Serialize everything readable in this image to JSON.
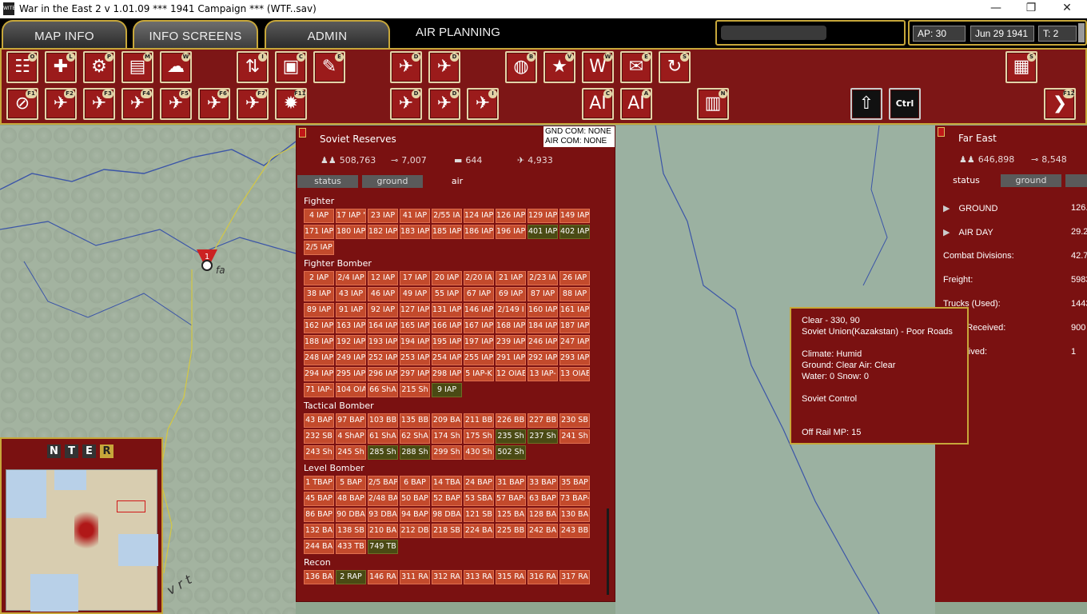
{
  "titlebar": {
    "text": "War in the East 2  v 1.01.09     ***   1941 Campaign   ***    (WTF..sav)",
    "min": "—",
    "max": "❐",
    "close": "✕"
  },
  "tabs": {
    "map_info": "MAP INFO",
    "info_screens": "INFO SCREENS",
    "admin": "ADMIN",
    "air_planning": "AIR PLANNING"
  },
  "status": {
    "ap": "AP: 30",
    "date": "Jun 29 1941",
    "turn": "T: 2"
  },
  "toolbar_row1": [
    {
      "name": "orders-icon",
      "key": "O",
      "g": "☷"
    },
    {
      "name": "leaders-icon",
      "key": "L",
      "g": "✚"
    },
    {
      "name": "production-icon",
      "key": "P",
      "g": "⚙"
    },
    {
      "name": "charts-icon",
      "key": "M",
      "g": "▤"
    },
    {
      "name": "weather-icon",
      "key": "W",
      "g": "☁"
    },
    {
      "name": "transfer-icon",
      "key": "I",
      "g": "⇅"
    },
    {
      "name": "commanders-icon",
      "key": "C",
      "g": "▣"
    },
    {
      "name": "events-icon",
      "key": "E",
      "g": "✎"
    },
    {
      "name": "air-dir-icon",
      "key": "D",
      "g": "✈"
    },
    {
      "name": "air-doc-icon",
      "key": "D",
      "g": "✈"
    },
    {
      "name": "globe-icon",
      "key": "B",
      "g": "◍"
    },
    {
      "name": "victory-icon",
      "key": "V",
      "g": "★"
    },
    {
      "name": "war-report-icon",
      "key": "W",
      "g": "W"
    },
    {
      "name": "announce-icon",
      "key": "E",
      "g": "✉"
    },
    {
      "name": "reload-icon",
      "key": "S",
      "g": "↻"
    }
  ],
  "toolbar_row2": [
    {
      "name": "air-no-icon",
      "key": "F1",
      "g": "⊘"
    },
    {
      "name": "air-ground-icon",
      "key": "F2",
      "g": "✈"
    },
    {
      "name": "air-strike-icon",
      "key": "F3",
      "g": "✈"
    },
    {
      "name": "air-industry-icon",
      "key": "F4",
      "g": "✈"
    },
    {
      "name": "air-patrol-icon",
      "key": "F5",
      "g": "✈"
    },
    {
      "name": "air-multi-icon",
      "key": "F6",
      "g": "✈"
    },
    {
      "name": "air-naval-icon",
      "key": "F7",
      "g": "✈"
    },
    {
      "name": "air-burn-icon",
      "key": "F11",
      "g": "✹"
    },
    {
      "name": "air-dir2-icon",
      "key": "D",
      "g": "✈"
    },
    {
      "name": "air-doc2-icon",
      "key": "D",
      "g": "✈"
    },
    {
      "name": "air-cross-icon",
      "key": "I",
      "g": "✈"
    },
    {
      "name": "ai-city-icon",
      "key": "C",
      "g": "AI"
    },
    {
      "name": "ai-air-icon",
      "key": "A",
      "g": "AI"
    },
    {
      "name": "factory-icon",
      "key": "N",
      "g": "▥"
    },
    {
      "name": "upload-icon",
      "key": "",
      "g": "⇧"
    },
    {
      "name": "ctrl-icon",
      "key": "",
      "g": "Ctrl"
    },
    {
      "name": "next-turn-icon",
      "key": "F12",
      "g": "❯"
    }
  ],
  "hq_icon": {
    "name": "hq-icon",
    "key": "S",
    "g": "▦"
  },
  "panel": {
    "title": "Soviet Reserves",
    "comm1": "GND COM: NONE",
    "comm2": "AIR COM: NONE",
    "men": "508,763",
    "guns": "7,007",
    "tanks": "644",
    "planes": "4,933",
    "tabs": [
      "status",
      "ground",
      "air"
    ]
  },
  "air_groups": [
    {
      "name": "Fighter",
      "units": [
        {
          "l": "4 IAP"
        },
        {
          "l": "17 IAP \""
        },
        {
          "l": "23 IAP"
        },
        {
          "l": "41 IAP"
        },
        {
          "l": "2/55 IA"
        },
        {
          "l": "124 IAP"
        },
        {
          "l": "126 IAP"
        },
        {
          "l": "129 IAP"
        },
        {
          "l": "149 IAP"
        },
        {
          "l": "171 IAP"
        },
        {
          "l": "180 IAP"
        },
        {
          "l": "182 IAP"
        },
        {
          "l": "183 IAP"
        },
        {
          "l": "185 IAP"
        },
        {
          "l": "186 IAP"
        },
        {
          "l": "196 IAP"
        },
        {
          "l": "401 IAP",
          "g": 1
        },
        {
          "l": "402 IAP",
          "g": 1
        },
        {
          "l": "2/5 IAP"
        }
      ]
    },
    {
      "name": "Fighter Bomber",
      "units": [
        {
          "l": "2 IAP"
        },
        {
          "l": "2/4 IAP"
        },
        {
          "l": "12 IAP"
        },
        {
          "l": "17 IAP"
        },
        {
          "l": "20 IAP"
        },
        {
          "l": "2/20 IA"
        },
        {
          "l": "21 IAP"
        },
        {
          "l": "2/23 IA"
        },
        {
          "l": "26 IAP"
        },
        {
          "l": "38 IAP"
        },
        {
          "l": "43 IAP"
        },
        {
          "l": "46 IAP"
        },
        {
          "l": "49 IAP"
        },
        {
          "l": "55 IAP"
        },
        {
          "l": "67 IAP"
        },
        {
          "l": "69 IAP"
        },
        {
          "l": "87 IAP"
        },
        {
          "l": "88 IAP"
        },
        {
          "l": "89 IAP"
        },
        {
          "l": "91 IAP"
        },
        {
          "l": "92 IAP"
        },
        {
          "l": "127 IAP"
        },
        {
          "l": "131 IAP"
        },
        {
          "l": "146 IAP"
        },
        {
          "l": "2/149 I"
        },
        {
          "l": "160 IAP"
        },
        {
          "l": "161 IAP"
        },
        {
          "l": "162 IAP"
        },
        {
          "l": "163 IAP"
        },
        {
          "l": "164 IAP"
        },
        {
          "l": "165 IAP"
        },
        {
          "l": "166 IAP"
        },
        {
          "l": "167 IAP"
        },
        {
          "l": "168 IAP"
        },
        {
          "l": "184 IAP"
        },
        {
          "l": "187 IAP"
        },
        {
          "l": "188 IAP"
        },
        {
          "l": "192 IAP"
        },
        {
          "l": "193 IAP"
        },
        {
          "l": "194 IAP"
        },
        {
          "l": "195 IAP"
        },
        {
          "l": "197 IAP"
        },
        {
          "l": "239 IAP"
        },
        {
          "l": "246 IAP"
        },
        {
          "l": "247 IAP"
        },
        {
          "l": "248 IAP"
        },
        {
          "l": "249 IAP"
        },
        {
          "l": "252 IAP"
        },
        {
          "l": "253 IAP"
        },
        {
          "l": "254 IAP"
        },
        {
          "l": "255 IAP"
        },
        {
          "l": "291 IAP"
        },
        {
          "l": "292 IAP"
        },
        {
          "l": "293 IAP"
        },
        {
          "l": "294 IAP"
        },
        {
          "l": "295 IAP"
        },
        {
          "l": "296 IAP"
        },
        {
          "l": "297 IAP"
        },
        {
          "l": "298 IAP"
        },
        {
          "l": "5 IAP-K"
        },
        {
          "l": "12 OIAE"
        },
        {
          "l": "13 IAP-"
        },
        {
          "l": "13 OIAE"
        },
        {
          "l": "71 IAP-"
        },
        {
          "l": "104 OIA"
        },
        {
          "l": "66 ShA"
        },
        {
          "l": "215 Sh"
        },
        {
          "l": "9 IAP",
          "g": 1
        }
      ]
    },
    {
      "name": "Tactical Bomber",
      "units": [
        {
          "l": "43 BAP"
        },
        {
          "l": "97 BAP"
        },
        {
          "l": "103 BB"
        },
        {
          "l": "135 BB"
        },
        {
          "l": "209 BA"
        },
        {
          "l": "211 BB"
        },
        {
          "l": "226 BB"
        },
        {
          "l": "227 BB"
        },
        {
          "l": "230 SB"
        },
        {
          "l": "232 SB"
        },
        {
          "l": "4 ShAP"
        },
        {
          "l": "61 ShA"
        },
        {
          "l": "62 ShA"
        },
        {
          "l": "174 Sh"
        },
        {
          "l": "175 Sh"
        },
        {
          "l": "235 Sh",
          "g": 1
        },
        {
          "l": "237 Sh",
          "g": 1
        },
        {
          "l": "241 Sh"
        },
        {
          "l": "243 Sh"
        },
        {
          "l": "245 Sh"
        },
        {
          "l": "285 Sh",
          "g": 1
        },
        {
          "l": "288 Sh",
          "g": 1
        },
        {
          "l": "299 Sh"
        },
        {
          "l": "430 Sh"
        },
        {
          "l": "502 Sh",
          "g": 1
        }
      ]
    },
    {
      "name": "Level Bomber",
      "units": [
        {
          "l": "1 TBAP"
        },
        {
          "l": "5 BAP"
        },
        {
          "l": "2/5 BAP"
        },
        {
          "l": "6 BAP"
        },
        {
          "l": "14 TBA"
        },
        {
          "l": "24 BAP"
        },
        {
          "l": "31 BAP"
        },
        {
          "l": "33 BAP"
        },
        {
          "l": "35 BAP"
        },
        {
          "l": "45 BAP"
        },
        {
          "l": "48 BAP"
        },
        {
          "l": "2/48 BA"
        },
        {
          "l": "50 BAP"
        },
        {
          "l": "52 BAP"
        },
        {
          "l": "53 SBA"
        },
        {
          "l": "57 BAP-"
        },
        {
          "l": "63 BAP"
        },
        {
          "l": "73 BAP-"
        },
        {
          "l": "86 BAP"
        },
        {
          "l": "90 DBA"
        },
        {
          "l": "93 DBA"
        },
        {
          "l": "94 BAP"
        },
        {
          "l": "98 DBA"
        },
        {
          "l": "121 SB"
        },
        {
          "l": "125 BA"
        },
        {
          "l": "128 BA"
        },
        {
          "l": "130 BA"
        },
        {
          "l": "132 BA"
        },
        {
          "l": "138 SB"
        },
        {
          "l": "210 BA"
        },
        {
          "l": "212 DB"
        },
        {
          "l": "218 SB"
        },
        {
          "l": "224 BA"
        },
        {
          "l": "225 BB"
        },
        {
          "l": "242 BA"
        },
        {
          "l": "243 BB"
        },
        {
          "l": "244 BA"
        },
        {
          "l": "433 TB"
        },
        {
          "l": "749 TB",
          "g": 1
        }
      ]
    },
    {
      "name": "Recon",
      "units": [
        {
          "l": "136 BA"
        },
        {
          "l": "2 RAP",
          "g": 1
        },
        {
          "l": "146 RA"
        },
        {
          "l": "311 RA"
        },
        {
          "l": "312 RA"
        },
        {
          "l": "313 RA"
        },
        {
          "l": "315 RA"
        },
        {
          "l": "316 RA"
        },
        {
          "l": "317 RA"
        }
      ]
    }
  ],
  "rpanel": {
    "title": "Far East",
    "men": "646,898",
    "guns": "8,548",
    "tabs": [
      "status",
      "ground"
    ],
    "rows": [
      {
        "l": "GROUND",
        "v": "126."
      },
      {
        "l": "AIR DAY",
        "v": "29.2"
      },
      {
        "l": "Combat Divisions:",
        "v": "42.7"
      },
      {
        "l": "Freight:",
        "v": "5983"
      },
      {
        "l": "Trucks (Used):",
        "v": "1443"
      },
      {
        "l": "Rem. Received:",
        "v": "900"
      },
      {
        "l": "t Received:",
        "v": "1"
      }
    ]
  },
  "tooltip": {
    "line1": "Clear - 330, 90",
    "line2": "Soviet Union(Kazakstan) - Poor Roads",
    "line3": "Climate: Humid",
    "line4": "Ground: Clear  Air: Clear",
    "line5": "Water: 0  Snow: 0",
    "line6": "Soviet Control",
    "line7": "Off Rail MP: 15"
  },
  "nter": [
    "N",
    "T",
    "E",
    "R"
  ],
  "map_labels": {
    "town": "fa",
    "river": "v r t"
  },
  "colors": {
    "panel": "#7a1111",
    "gold": "#c7a73a",
    "unit": "#c34a2c",
    "unit_ready": "#4a4a14"
  }
}
